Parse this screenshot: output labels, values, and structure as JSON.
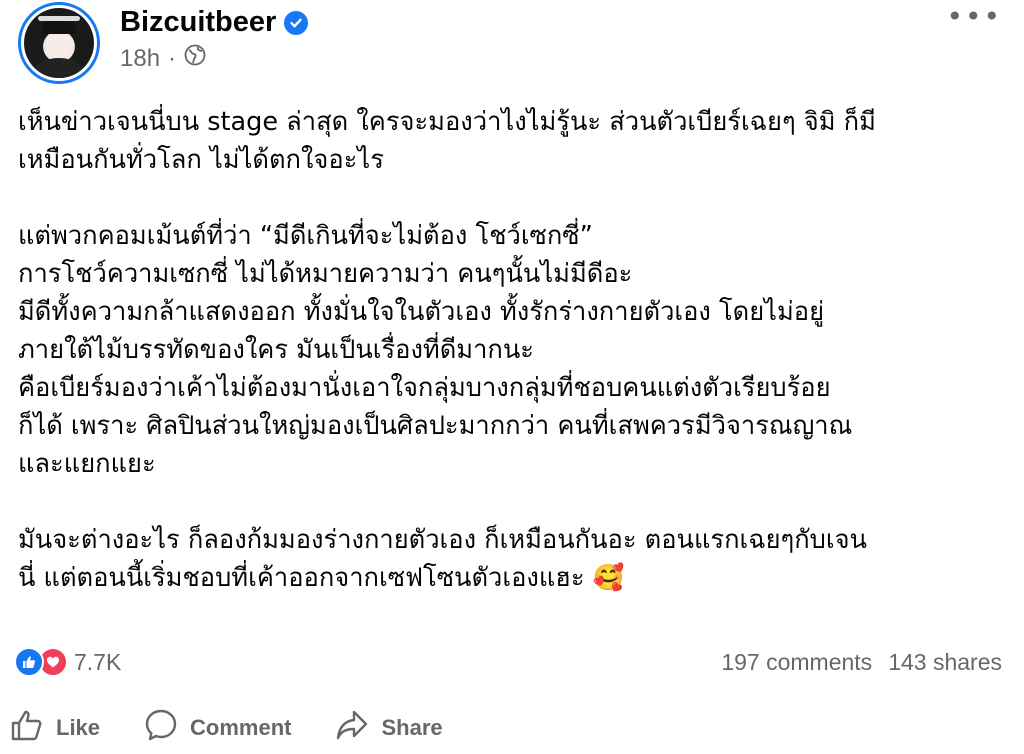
{
  "post": {
    "author": "Bizcuitbeer",
    "time": "18h",
    "separator": "·",
    "paragraphs": [
      [
        "เห็นข่าวเจนนี่บน stage ล่าสุด ใครจะมองว่าไงไม่รู้นะ ส่วนตัวเบียร์เฉยๆ จิมิ ก็มี",
        "เหมือนกันทั่วโลก ไม่ได้ตกใจอะไร"
      ],
      [
        "แต่พวกคอมเม้นต์ที่ว่า “มีดีเกินที่จะไม่ต้อง โชว์เซกซี่”",
        "การโชว์ความเซกซี่ ไม่ได้หมายความว่า คนๆนั้นไม่มีดีอะ",
        "มีดีทั้งความกล้าแสดงออก ทั้งมั่นใจในตัวเอง ทั้งรักร่างกายตัวเอง โดยไม่อยู่",
        "ภายใต้ไม้บรรทัดของใคร มันเป็นเรื่องที่ดีมากนะ",
        "คือเบียร์มองว่าเค้าไม่ต้องมานั่งเอาใจกลุ่มบางกลุ่มที่ชอบคนแต่งตัวเรียบร้อย",
        "ก็ได้ เพราะ ศิลปินส่วนใหญ่มองเป็นศิลปะมากกว่า คนที่เสพควรมีวิจารณญาณ",
        "และแยกแยะ"
      ],
      [
        "มันจะต่างอะไร ก็ลองก้มมองร่างกายตัวเอง ก็เหมือนกันอะ ตอนแรกเฉยๆกับเจน",
        "นี่ แต่ตอนนี้เริ่มชอบที่เค้าออกจากเซฟโซนตัวเองแฮะ 🥰"
      ]
    ]
  },
  "stats": {
    "reactions": "7.7K",
    "comments": "197 comments",
    "shares": "143 shares"
  },
  "actions": {
    "like": "Like",
    "comment": "Comment",
    "share": "Share"
  },
  "more_label": "•••",
  "colors": {
    "accent": "#1877f2",
    "love": "#f33e58",
    "muted": "#65676b"
  }
}
